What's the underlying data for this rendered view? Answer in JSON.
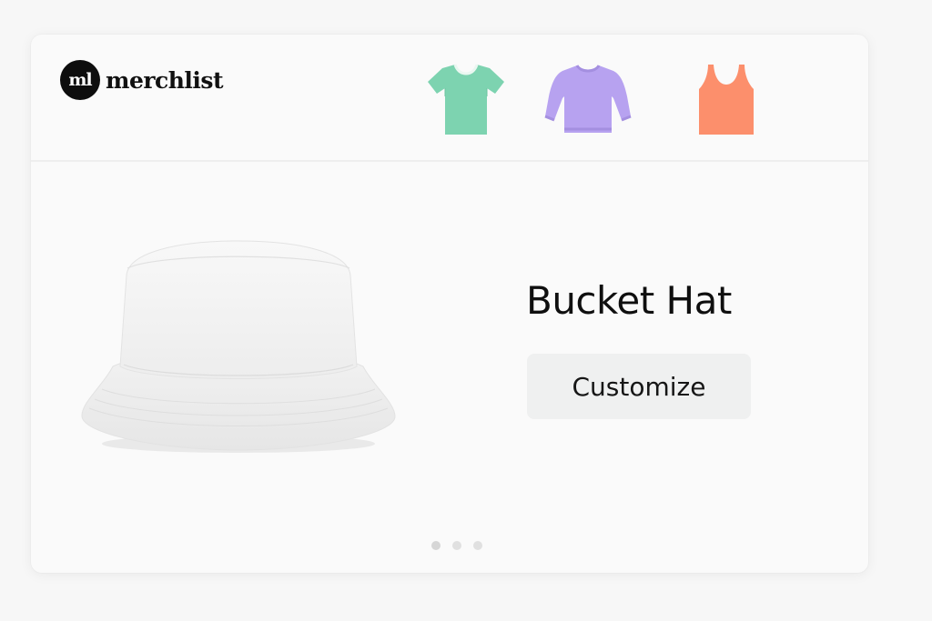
{
  "brand": {
    "mark": "ml",
    "name": "merchlist"
  },
  "header": {
    "thumbnails": [
      {
        "label": "T-shirt",
        "icon": "tshirt-icon",
        "color": "#7dd3b0"
      },
      {
        "label": "Sweatshirt",
        "icon": "sweatshirt-icon",
        "color": "#b7a2f0"
      },
      {
        "label": "Tank top",
        "icon": "tank-top-icon",
        "color": "#fc8f6c"
      }
    ]
  },
  "product": {
    "title": "Bucket Hat",
    "image_icon": "bucket-hat-image",
    "cta_label": "Customize"
  },
  "carousel": {
    "slide_count": 3,
    "active_index": 0
  },
  "colors": {
    "background": "#f7f7f7",
    "card": "#fafafa",
    "button": "#eff0f0",
    "text": "#0f0f0f"
  }
}
